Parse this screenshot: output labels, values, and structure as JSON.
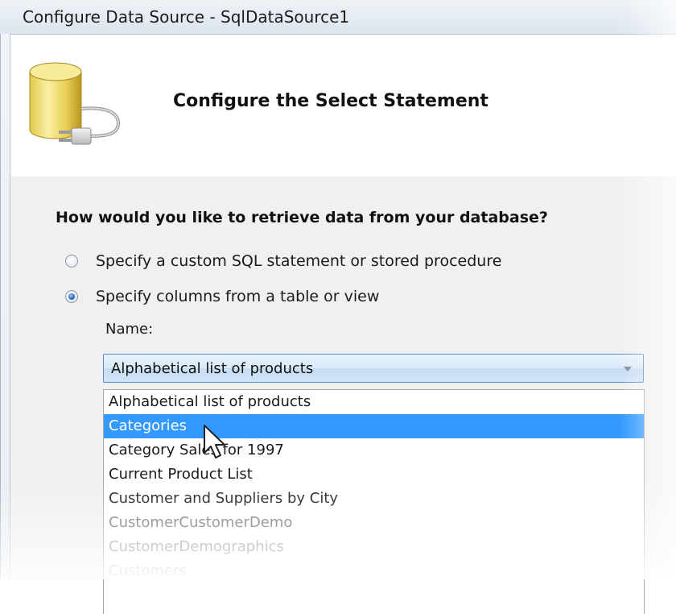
{
  "window": {
    "title": "Configure Data Source - SqlDataSource1"
  },
  "header": {
    "title": "Configure the Select Statement",
    "icon": "database-plug-icon"
  },
  "main": {
    "question": "How would you like to retrieve data from your database?",
    "options": [
      {
        "label": "Specify a custom SQL statement or stored procedure",
        "selected": false
      },
      {
        "label": "Specify columns from a table or view",
        "selected": true
      }
    ],
    "name_label": "Name:",
    "combo": {
      "value": "Alphabetical list of products"
    },
    "dropdown_items": [
      "Alphabetical list of products",
      "Categories",
      "Category Sales for 1997",
      "Current Product List",
      "Customer and Suppliers by City",
      "CustomerCustomerDemo",
      "CustomerDemographics",
      "Customers"
    ],
    "highlighted_item": "Categories"
  },
  "colors": {
    "selection": "#3399ff",
    "combo_border": "#5d8dc9"
  }
}
